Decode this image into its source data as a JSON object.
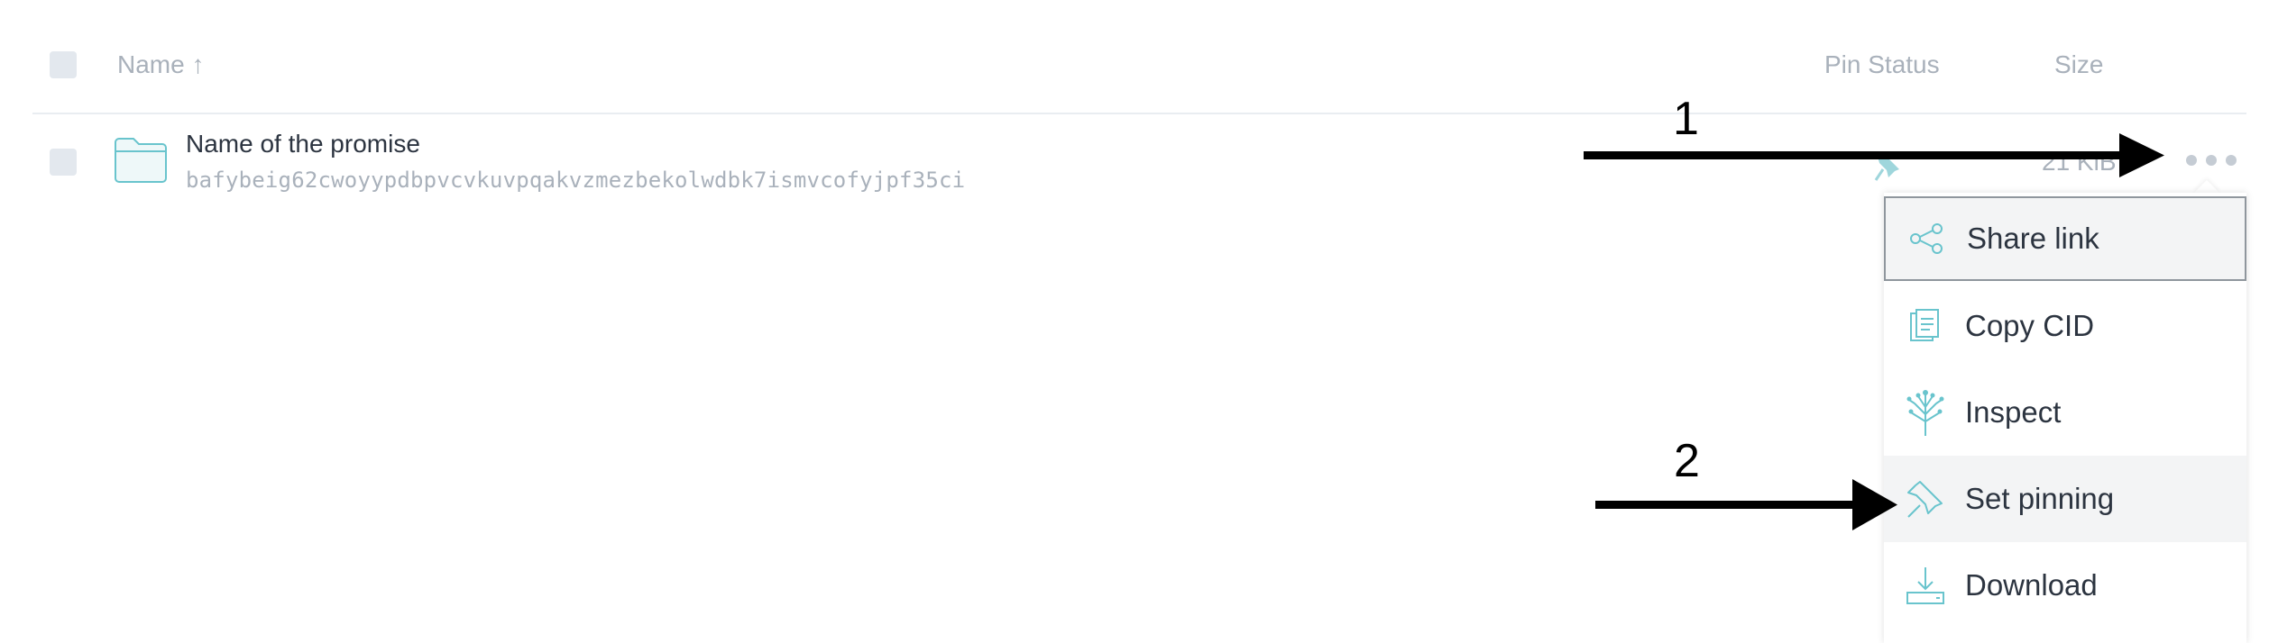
{
  "header": {
    "name_label": "Name",
    "sort_arrow": "↑",
    "pin_status_label": "Pin Status",
    "size_label": "Size"
  },
  "row": {
    "name": "Name of the promise",
    "cid": "bafybeig62cwoyypdbpvcvkuvpqakvzmezbekolwdbk7ismvcofyjpf35ci",
    "size": "21 KiB",
    "icons": [
      "folder-icon",
      "pin-icon"
    ]
  },
  "menu": {
    "items": [
      {
        "label": "Share link",
        "icon": "share-icon"
      },
      {
        "label": "Copy CID",
        "icon": "copy-icon"
      },
      {
        "label": "Inspect",
        "icon": "inspect-icon"
      },
      {
        "label": "Set pinning",
        "icon": "pin-icon"
      },
      {
        "label": "Download",
        "icon": "download-icon"
      }
    ]
  },
  "annotations": {
    "step1": "1",
    "step2": "2"
  },
  "colors": {
    "accent": "#69c4cd",
    "muted": "#a9b1bb",
    "text": "#2c3440"
  }
}
